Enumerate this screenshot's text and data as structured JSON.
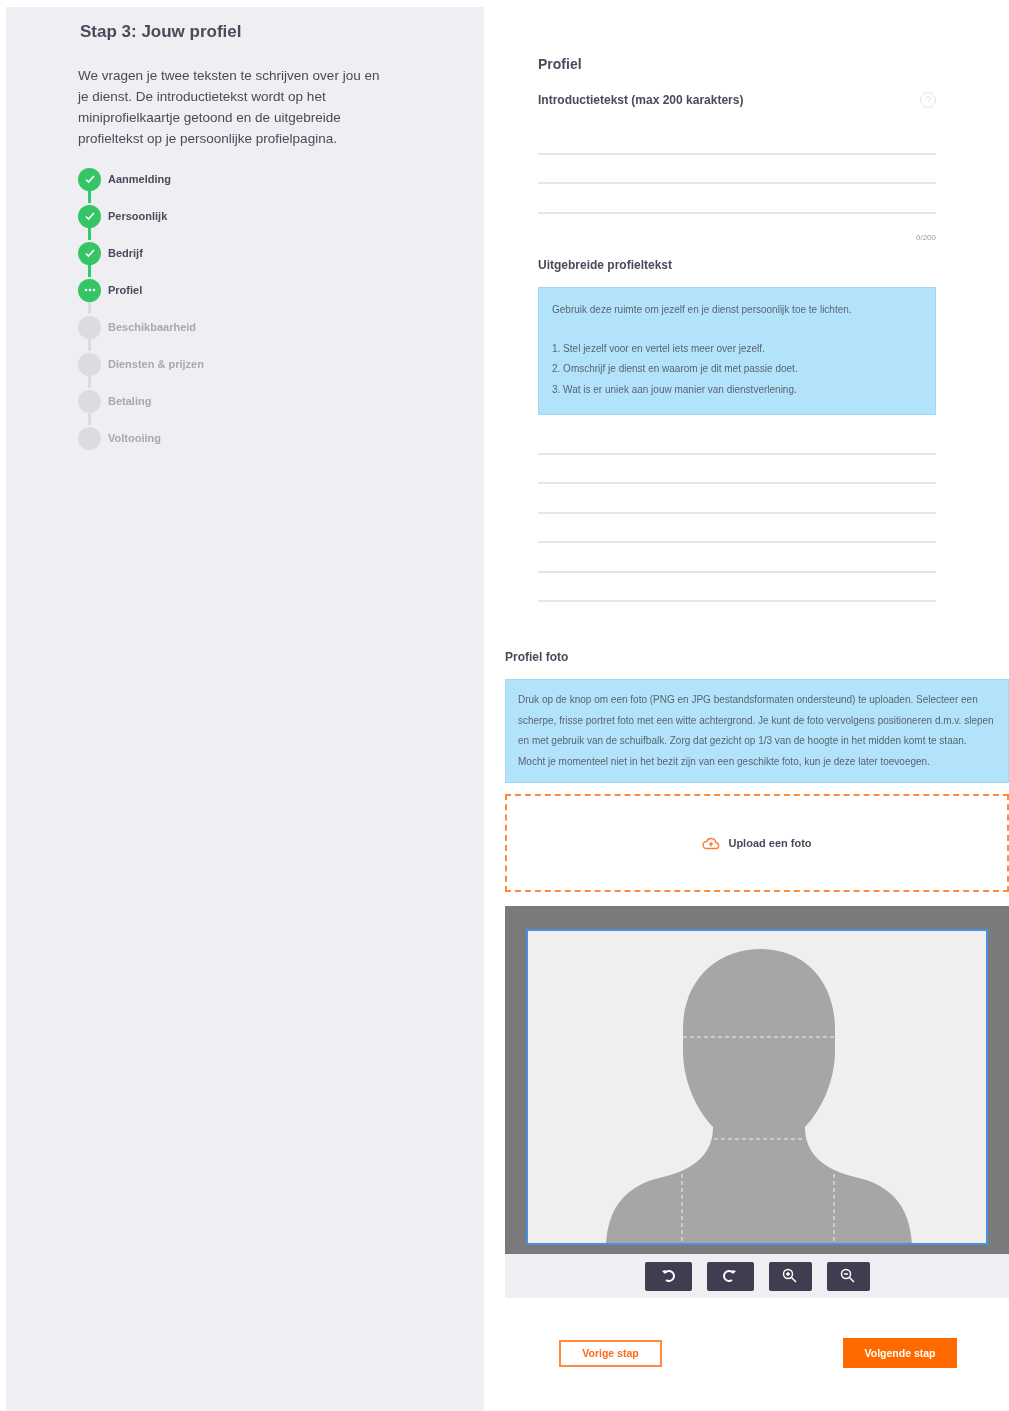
{
  "sidebar": {
    "title": "Stap 3: Jouw profiel",
    "intro": "We vragen je twee teksten te schrijven over jou en je dienst. De introductietekst wordt op het miniprofielkaartje getoond en de uitgebreide profieltekst op je persoonlijke profielpagina.",
    "steps": [
      {
        "label": "Aanmelding",
        "kind": "done"
      },
      {
        "label": "Persoonlijk",
        "kind": "done"
      },
      {
        "label": "Bedrijf",
        "kind": "done"
      },
      {
        "label": "Profiel",
        "kind": "current"
      },
      {
        "label": "Beschikbaarheid",
        "kind": "pending"
      },
      {
        "label": "Diensten & prijzen",
        "kind": "pending"
      },
      {
        "label": "Betaling",
        "kind": "pending"
      },
      {
        "label": "Voltooiing",
        "kind": "pending"
      }
    ]
  },
  "profile": {
    "heading": "Profiel",
    "intro_label": "Introductietekst (max 200 karakters)",
    "counter": "0/200",
    "extended_label": "Uitgebreide profieltekst",
    "extended_hint": "Gebruik deze ruimte om jezelf en je dienst persoonlijk toe te lichten.",
    "extended_points": [
      "1. Stel jezelf voor en vertel iets meer over jezelf.",
      "2. Omschrijf je dienst en waarom je dit met passie doet.",
      "3. Wat is er uniek aan jouw manier van dienstverlening."
    ]
  },
  "photo": {
    "heading": "Profiel foto",
    "info": "Druk op de knop om een foto (PNG en JPG bestandsformaten ondersteund) te uploaden. Selecteer een scherpe, frisse portret foto met een witte achtergrond. Je kunt de foto vervolgens positioneren d.m.v. slepen en met gebruik van de schuifbalk. Zorg dat gezicht op 1/3 van de hoogte in het midden komt te staan. Mocht je momenteel niet in het bezit zijn van een geschikte foto, kun je deze later toevoegen.",
    "upload_label": "Upload een foto",
    "tools": [
      {
        "kind": "rotate-left"
      },
      {
        "kind": "rotate-right"
      },
      {
        "kind": "zoom-in"
      },
      {
        "kind": "zoom-out"
      }
    ]
  },
  "buttons": {
    "previous": "Vorige stap",
    "next": "Volgende stap"
  }
}
